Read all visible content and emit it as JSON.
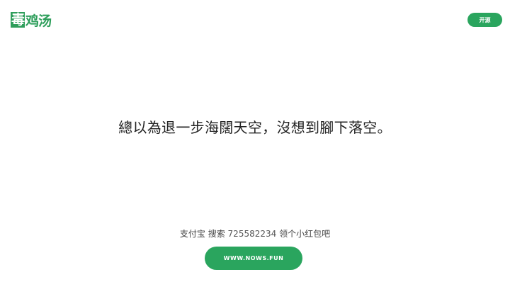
{
  "header": {
    "logo_first": "毒",
    "logo_rest": "鸡汤",
    "open_button": "开源"
  },
  "main": {
    "quote": "總以為退一步海闊天空，沒想到腳下落空。"
  },
  "footer": {
    "promo_prefix": "支付宝 搜索",
    "promo_code": "725582234",
    "promo_suffix": "领个小红包吧",
    "url_button": "WWW.NOWS.FUN"
  },
  "colors": {
    "accent": "#2aa55e",
    "text": "#222222",
    "background": "#ffffff"
  }
}
